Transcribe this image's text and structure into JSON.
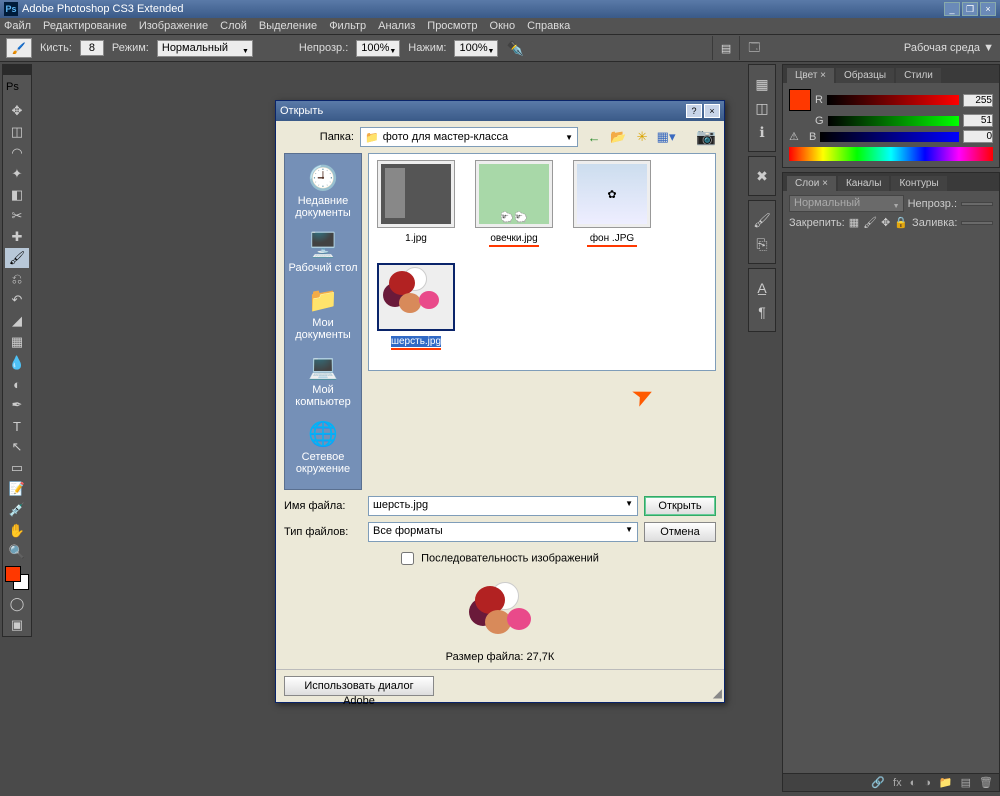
{
  "app": {
    "title": "Adobe Photoshop CS3 Extended"
  },
  "menu": [
    "Файл",
    "Редактирование",
    "Изображение",
    "Слой",
    "Выделение",
    "Фильтр",
    "Анализ",
    "Просмотр",
    "Окно",
    "Справка"
  ],
  "options": {
    "brush_label": "Кисть:",
    "brush_size": "8",
    "mode_label": "Режим:",
    "mode_value": "Нормальный",
    "opacity_label": "Непрозр.:",
    "opacity_value": "100%",
    "flow_label": "Нажим:",
    "flow_value": "100%",
    "workspace_label": "Рабочая среда ▼"
  },
  "color_panel": {
    "tabs": [
      "Цвет ×",
      "Образцы",
      "Стили"
    ],
    "channels": {
      "R": 255,
      "G": 51,
      "B": 0
    }
  },
  "layers_panel": {
    "tabs": [
      "Слои ×",
      "Каналы",
      "Контуры"
    ],
    "mode": "Нормальный",
    "opacity_label": "Непрозр.:",
    "lock_label": "Закрепить:",
    "fill_label": "Заливка:"
  },
  "dialog": {
    "title": "Открыть",
    "folder_label": "Папка:",
    "folder_value": "фото для мастер-класса",
    "sidebar": [
      {
        "icon": "🕘",
        "label": "Недавние документы"
      },
      {
        "icon": "🖥️",
        "label": "Рабочий стол"
      },
      {
        "icon": "📁",
        "label": "Мои документы"
      },
      {
        "icon": "💻",
        "label": "Мой компьютер"
      },
      {
        "icon": "🌐",
        "label": "Сетевое окружение"
      }
    ],
    "files": [
      {
        "name": "1.jpg",
        "underline": false,
        "selected": false,
        "thumb": "doc"
      },
      {
        "name": "овечки.jpg",
        "underline": true,
        "selected": false,
        "thumb": "sheep"
      },
      {
        "name": "фон .JPG",
        "underline": true,
        "selected": false,
        "thumb": "bg"
      },
      {
        "name": "шерсть.jpg",
        "underline": true,
        "selected": true,
        "thumb": "yarn"
      }
    ],
    "filename_label": "Имя файла:",
    "filename_value": "шерсть.jpg",
    "filetype_label": "Тип файлов:",
    "filetype_value": "Все форматы",
    "open_btn": "Открыть",
    "cancel_btn": "Отмена",
    "sequence_label": "Последовательность изображений",
    "filesize_label": "Размер файла: 27,7К",
    "adobe_btn": "Использовать диалог Adobe"
  }
}
